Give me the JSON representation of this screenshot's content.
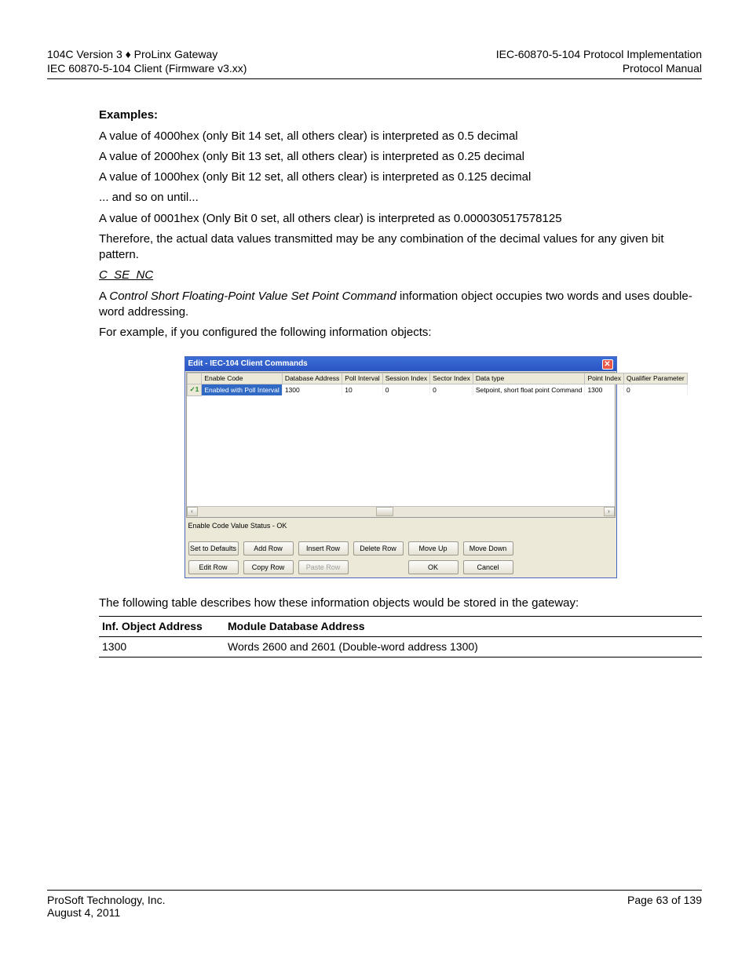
{
  "header": {
    "left1": "104C Version 3 ♦ ProLinx Gateway",
    "left2": "IEC 60870-5-104 Client (Firmware v3.xx)",
    "right1": "IEC-60870-5-104 Protocol Implementation",
    "right2": "Protocol Manual"
  },
  "examples": {
    "heading": "Examples:",
    "p1": "A value of 4000hex (only Bit 14 set, all others clear) is interpreted as 0.5 decimal",
    "p2": "A value of 2000hex (only Bit 13 set, all others clear) is interpreted as 0.25 decimal",
    "p3": "A value of 1000hex (only Bit 12 set, all others clear) is interpreted as 0.125 decimal",
    "p4": "... and so on until...",
    "p5": "A value of 0001hex (Only Bit 0 set, all others clear) is interpreted as 0.000030517578125",
    "p6": "Therefore, the actual data values transmitted may be any combination of the decimal values for any given bit pattern."
  },
  "section": {
    "heading": "C_SE_NC",
    "p1a": "A ",
    "p1b": "Control Short Floating-Point Value Set Point Command",
    "p1c": " information object occupies two words and uses double-word addressing.",
    "p2": "For example, if you configured the following information objects:"
  },
  "dialog": {
    "title": "Edit - IEC-104 Client Commands",
    "columns": [
      "",
      "Enable Code",
      "Database Address",
      "Poll Interval",
      "Session Index",
      "Sector Index",
      "Data type",
      "Point Index",
      "Qualifier Parameter"
    ],
    "row": {
      "index": "1",
      "check": "✓",
      "enable_code": "Enabled with Poll Interval",
      "db_addr": "1300",
      "poll_interval": "10",
      "session_index": "0",
      "sector_index": "0",
      "data_type": "Setpoint, short float point Command",
      "point_index": "1300",
      "qualifier": "0"
    },
    "status": "Enable Code Value Status - OK",
    "buttons1": [
      "Set to Defaults",
      "Add Row",
      "Insert Row",
      "Delete Row",
      "Move Up",
      "Move Down"
    ],
    "buttons2": [
      "Edit Row",
      "Copy Row",
      "Paste Row",
      "",
      "OK",
      "Cancel"
    ]
  },
  "after_dialog": "The following table describes how these information objects would be stored in the gateway:",
  "table": {
    "h1": "Inf. Object Address",
    "h2": "Module Database Address",
    "r1c1": "1300",
    "r1c2": "Words 2600 and 2601 (Double-word address 1300)"
  },
  "footer": {
    "left1": "ProSoft Technology, Inc.",
    "left2": "August 4, 2011",
    "right": "Page 63 of 139"
  }
}
